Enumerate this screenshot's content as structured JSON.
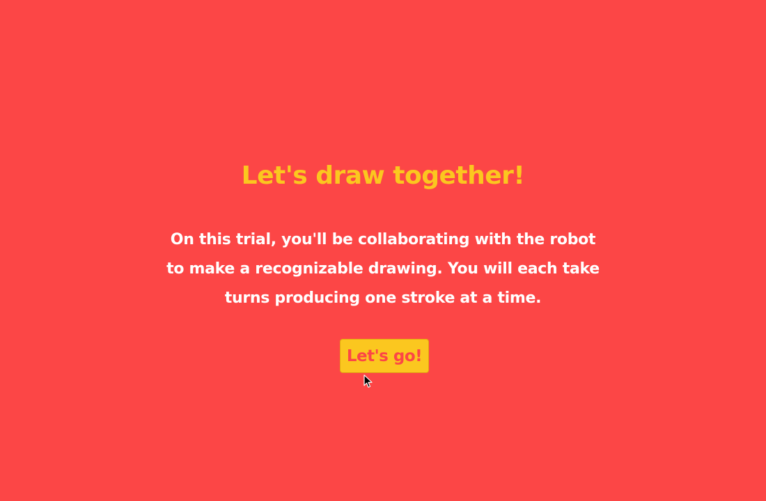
{
  "page": {
    "background_color": "#fc4646"
  },
  "intro": {
    "title": "Let's draw together!",
    "instructions": "On this trial, you'll be collaborating with the robot to make a recognizable drawing. You will each take turns producing one stroke at a time.",
    "start_button_label": "Let's go!"
  },
  "colors": {
    "title": "#fbc71f",
    "text": "#ffffff",
    "button_bg": "#fbc71f",
    "button_text": "#fc4646"
  },
  "cursor": {
    "icon": "pointer-arrow-icon"
  }
}
